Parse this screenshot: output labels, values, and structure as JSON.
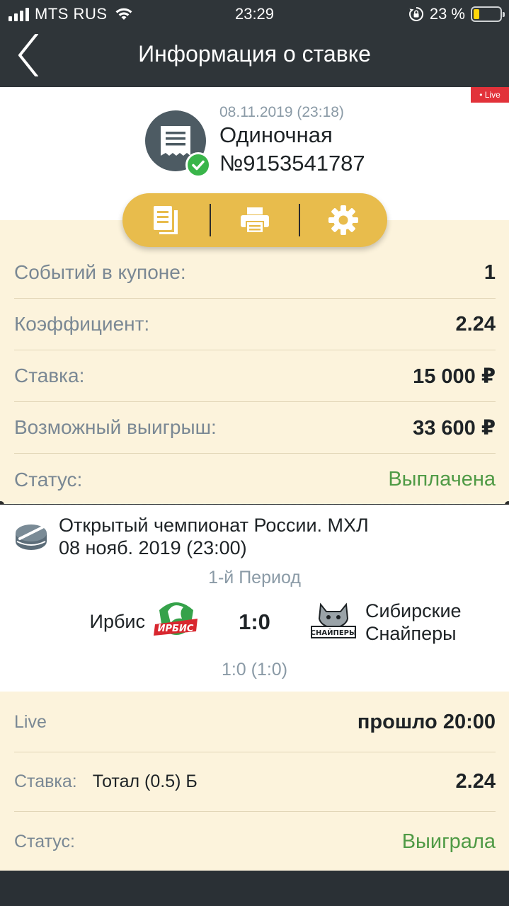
{
  "status_bar": {
    "carrier": "MTS RUS",
    "time": "23:29",
    "battery_pct": "23 %",
    "battery_level": 0.23,
    "battery_color": "#ffd60a"
  },
  "nav": {
    "title": "Информация о ставке",
    "back_icon": "chevron-left-icon"
  },
  "bet": {
    "live_tag": "• Live",
    "date": "08.11.2019 (23:18)",
    "type": "Одиночная",
    "number": "№9153541787",
    "icon": "receipt-icon",
    "status_icon": "check-circle-icon"
  },
  "actions": [
    {
      "name": "copy-coupon",
      "icon": "document-copy-icon"
    },
    {
      "name": "print",
      "icon": "printer-icon"
    },
    {
      "name": "settings",
      "icon": "gear-icon"
    }
  ],
  "summary": [
    {
      "label": "Событий в купоне:",
      "value": "1"
    },
    {
      "label": "Коэффициент:",
      "value": "2.24"
    },
    {
      "label": "Ставка:",
      "value": "15 000 ₽"
    },
    {
      "label": "Возможный выигрыш:",
      "value": "33 600 ₽"
    },
    {
      "label": "Статус:",
      "value": "Выплачена"
    }
  ],
  "event": {
    "sport_icon": "hockey-puck-icon",
    "tournament": "Открытый чемпионат России. МХЛ",
    "date": "08 нояб. 2019 (23:00)",
    "period": "1-й Период",
    "home_team": "Ирбис",
    "home_logo_text": "ИРБИС",
    "score": "1:0",
    "away_team_line1": "Сибирские",
    "away_team_line2": "Снайперы",
    "away_logo_text": "СНАЙПЕРЫ",
    "score_detail": "1:0 (1:0)"
  },
  "details": {
    "live_label": "Live",
    "live_value": "прошло 20:00",
    "bet_label": "Ставка:",
    "bet_outcome": "Тотал (0.5) Б",
    "bet_odds": "2.24",
    "status_label": "Статус:",
    "status_value": "Выиграла"
  },
  "colors": {
    "header": "#2f3539",
    "cream": "#fcf3dc",
    "accent": "#e8bc4c",
    "success": "#4f9a45",
    "live": "#e2323a"
  }
}
